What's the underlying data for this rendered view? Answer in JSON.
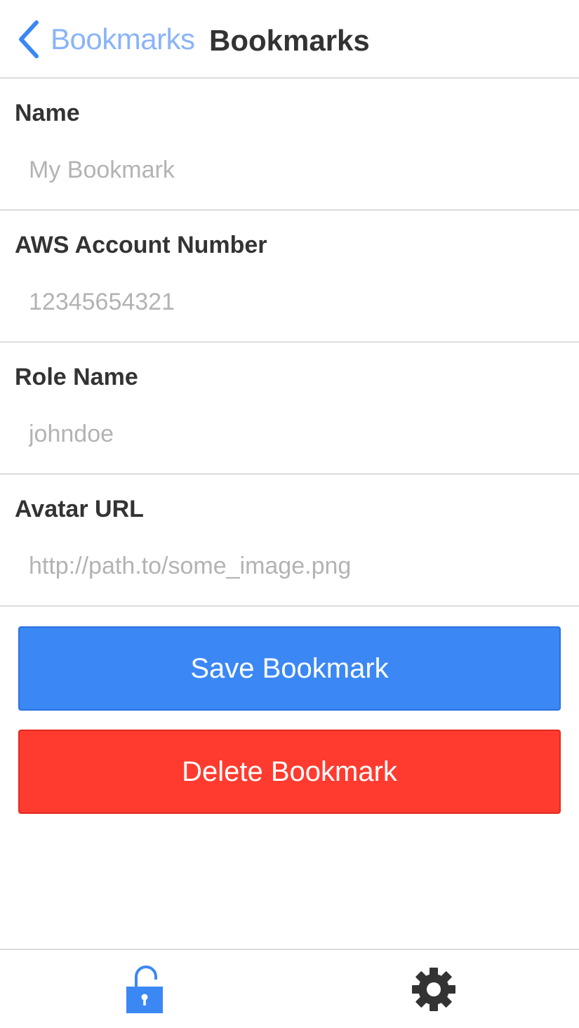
{
  "nav": {
    "back_label": "Bookmarks",
    "title": "Bookmarks",
    "back_icon": "chevron-left-icon"
  },
  "form": {
    "fields": [
      {
        "label": "Name",
        "value": "",
        "placeholder": "My Bookmark"
      },
      {
        "label": "AWS Account Number",
        "value": "",
        "placeholder": "12345654321"
      },
      {
        "label": "Role Name",
        "value": "",
        "placeholder": "johndoe"
      },
      {
        "label": "Avatar URL",
        "value": "",
        "placeholder": "http://path.to/some_image.png"
      }
    ]
  },
  "actions": {
    "save_label": "Save Bookmark",
    "delete_label": "Delete Bookmark"
  },
  "tabbar": {
    "items": [
      {
        "icon": "unlock-icon",
        "active": true
      },
      {
        "icon": "gear-icon",
        "active": false
      }
    ]
  },
  "colors": {
    "accent": "#3b88f5",
    "danger": "#ff3b2f",
    "back_link": "#8ab4f8",
    "divider": "#dcdcdc",
    "placeholder": "#b3b3b3",
    "text": "#333333"
  }
}
